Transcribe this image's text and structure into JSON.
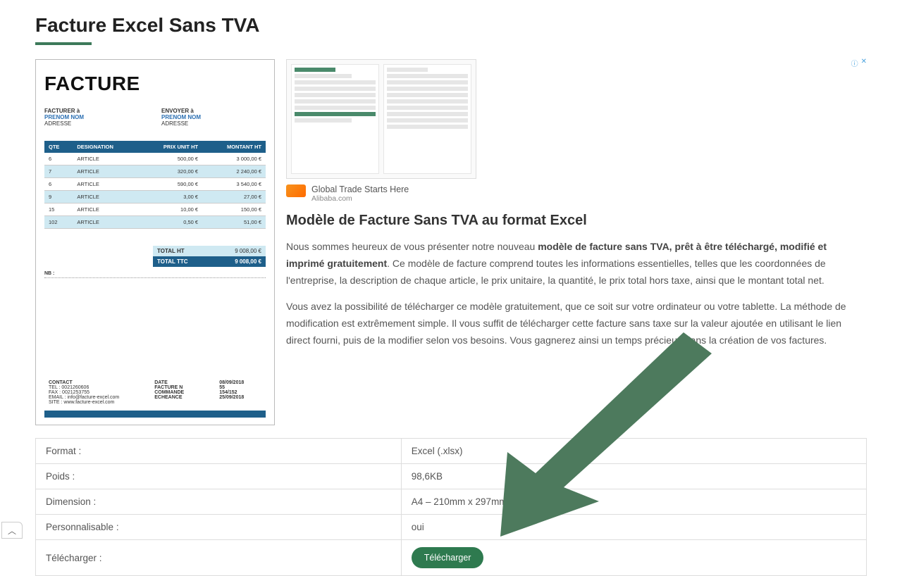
{
  "title": "Facture Excel Sans TVA",
  "invoice_preview": {
    "heading": "FACTURE",
    "bill_to": {
      "label": "FACTURER à",
      "name": "PRENOM NOM",
      "addr": "ADRESSE"
    },
    "ship_to": {
      "label": "ENVOYER à",
      "name": "PRENOM NOM",
      "addr": "ADRESSE"
    },
    "headers": {
      "qty": "QTE",
      "desc": "DESIGNATION",
      "unit": "PRIX UNIT HT",
      "amount": "MONTANT HT"
    },
    "rows": [
      {
        "qty": "6",
        "desc": "ARTICLE",
        "unit": "500,00 €",
        "amount": "3 000,00 €"
      },
      {
        "qty": "7",
        "desc": "ARTICLE",
        "unit": "320,00 €",
        "amount": "2 240,00 €"
      },
      {
        "qty": "6",
        "desc": "ARTICLE",
        "unit": "590,00 €",
        "amount": "3 540,00 €"
      },
      {
        "qty": "9",
        "desc": "ARTICLE",
        "unit": "3,00 €",
        "amount": "27,00 €"
      },
      {
        "qty": "15",
        "desc": "ARTICLE",
        "unit": "10,00 €",
        "amount": "150,00 €"
      },
      {
        "qty": "102",
        "desc": "ARTICLE",
        "unit": "0,50 €",
        "amount": "51,00 €"
      }
    ],
    "totals": {
      "ht_label": "TOTAL HT",
      "ht_value": "9 008,00 €",
      "ttc_label": "TOTAL TTC",
      "ttc_value": "9 008,00 €"
    },
    "nb_label": "NB :",
    "footer": {
      "contact_label": "CONTACT",
      "tel": "TEL : 0021260606",
      "fax": "FAX : 0021253755",
      "mail": "EMAIL : info@facture-excel.com",
      "site": "SITE : www.facture-excel.com",
      "date_label": "DATE",
      "date_value": "08/09/2018",
      "invno_label": "FACTURE N",
      "invno_value": "55",
      "order_label": "COMMANDE",
      "order_value": "154/152",
      "due_label": "ECHEANCE",
      "due_value": "25/09/2018"
    }
  },
  "ad": {
    "close_info_glyph": "ⓘ",
    "close_x_glyph": "✕",
    "headline": "Global Trade Starts Here",
    "source": "Alibaba.com"
  },
  "section_title": "Modèle de Facture Sans TVA au format Excel",
  "para1_pre": "Nous sommes heureux de vous présenter notre nouveau ",
  "para1_bold": "modèle de facture sans TVA, prêt à être téléchargé, modifié et imprimé gratuitement",
  "para1_post": ". Ce modèle de facture comprend toutes les informations essentielles, telles que les coordonnées de l'entreprise, la description de chaque article, le prix unitaire, la quantité, le prix total hors taxe, ainsi que le montant total net.",
  "para2": "Vous avez la possibilité de télécharger ce modèle gratuitement, que ce soit sur votre ordinateur ou votre tablette. La méthode de modification est extrêmement simple. Il vous suffit de télécharger cette facture sans taxe sur la valeur ajoutée en utilisant le lien direct fourni, puis de la modifier selon vos besoins. Vous gagnerez ainsi un temps précieux dans la création de vos factures.",
  "info_table": {
    "format_label": "Format :",
    "format_value": "Excel (.xlsx)",
    "size_label": "Poids :",
    "size_value": "98,6KB",
    "dim_label": "Dimension :",
    "dim_value": "A4 – 210mm x 297mm",
    "custom_label": "Personnalisable :",
    "custom_value": "oui",
    "download_label": "Télécharger :",
    "download_button": "Télécharger"
  },
  "scroll_top_glyph": "︿"
}
